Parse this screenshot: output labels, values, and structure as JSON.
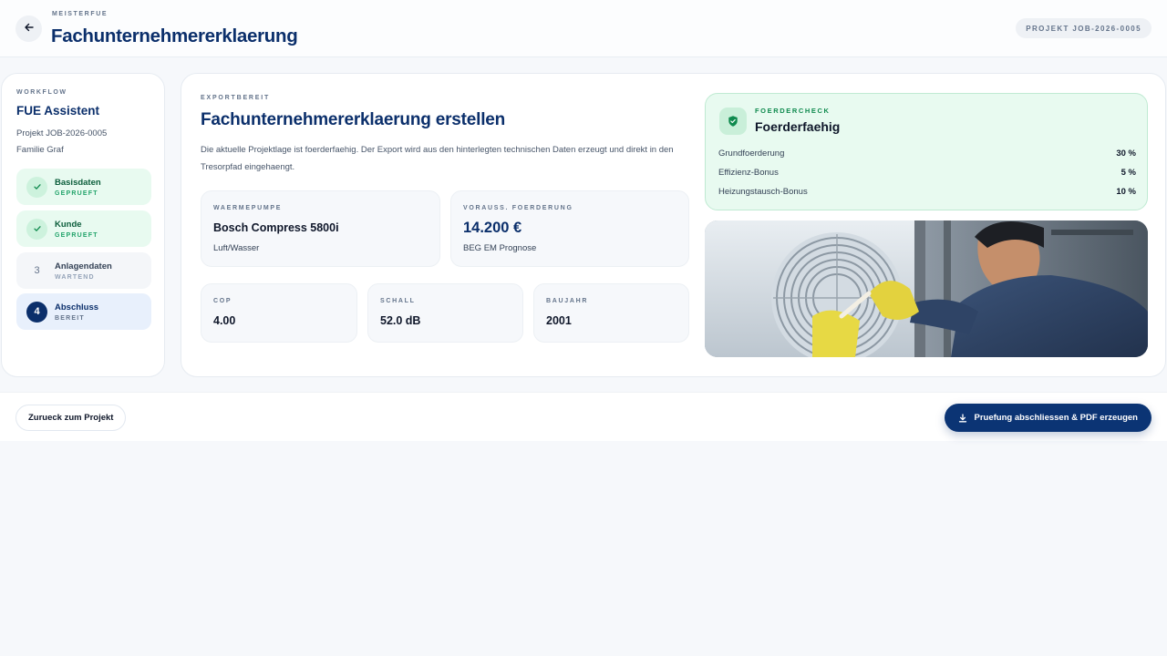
{
  "header": {
    "brand": "MEISTERFUE",
    "title": "Fachunternehmererklaerung",
    "project_pill": "PROJEKT JOB-2026-0005"
  },
  "sidebar": {
    "label": "WORKFLOW",
    "title": "FUE Assistent",
    "project": "Projekt JOB-2026-0005",
    "customer": "Familie Graf",
    "steps": [
      {
        "marker": "",
        "name": "Basisdaten",
        "status": "GEPRUEFT"
      },
      {
        "marker": "",
        "name": "Kunde",
        "status": "GEPRUEFT"
      },
      {
        "marker": "3",
        "name": "Anlagendaten",
        "status": "WARTEND"
      },
      {
        "marker": "4",
        "name": "Abschluss",
        "status": "BEREIT"
      }
    ]
  },
  "main": {
    "label": "EXPORTBEREIT",
    "title": "Fachunternehmererklaerung erstellen",
    "description": "Die aktuelle Projektlage ist foerderfaehig. Der Export wird aus den hinterlegten technischen Daten erzeugt und direkt in den Tresorpfad eingehaengt.",
    "heatpump": {
      "label": "WAERMEPUMPE",
      "value": "Bosch Compress 5800i",
      "sub": "Luft/Wasser"
    },
    "funding": {
      "label": "VORAUSS. FOERDERUNG",
      "value": "14.200 €",
      "sub": "BEG EM Prognose"
    },
    "cop": {
      "label": "COP",
      "value": "4.00"
    },
    "sound": {
      "label": "SCHALL",
      "value": "52.0 dB"
    },
    "year": {
      "label": "BAUJAHR",
      "value": "2001"
    }
  },
  "check": {
    "label": "FOERDERCHECK",
    "title": "Foerderfaehig",
    "rows": [
      {
        "name": "Grundfoerderung",
        "value": "30 %"
      },
      {
        "name": "Effizienz-Bonus",
        "value": "5 %"
      },
      {
        "name": "Heizungstausch-Bonus",
        "value": "10 %"
      }
    ]
  },
  "footer": {
    "back_label": "Zurueck zum Projekt",
    "primary_label": "Pruefung abschliessen & PDF erzeugen"
  },
  "icons": {
    "back": "arrow-left-icon",
    "check_done": "checkmark-icon",
    "shield": "shield-check-icon",
    "download": "download-icon"
  },
  "colors": {
    "brand": "#0b2f6b",
    "success_bg": "#e8faf0",
    "success": "#0f8a4e",
    "primary_button": "#0b3474"
  }
}
